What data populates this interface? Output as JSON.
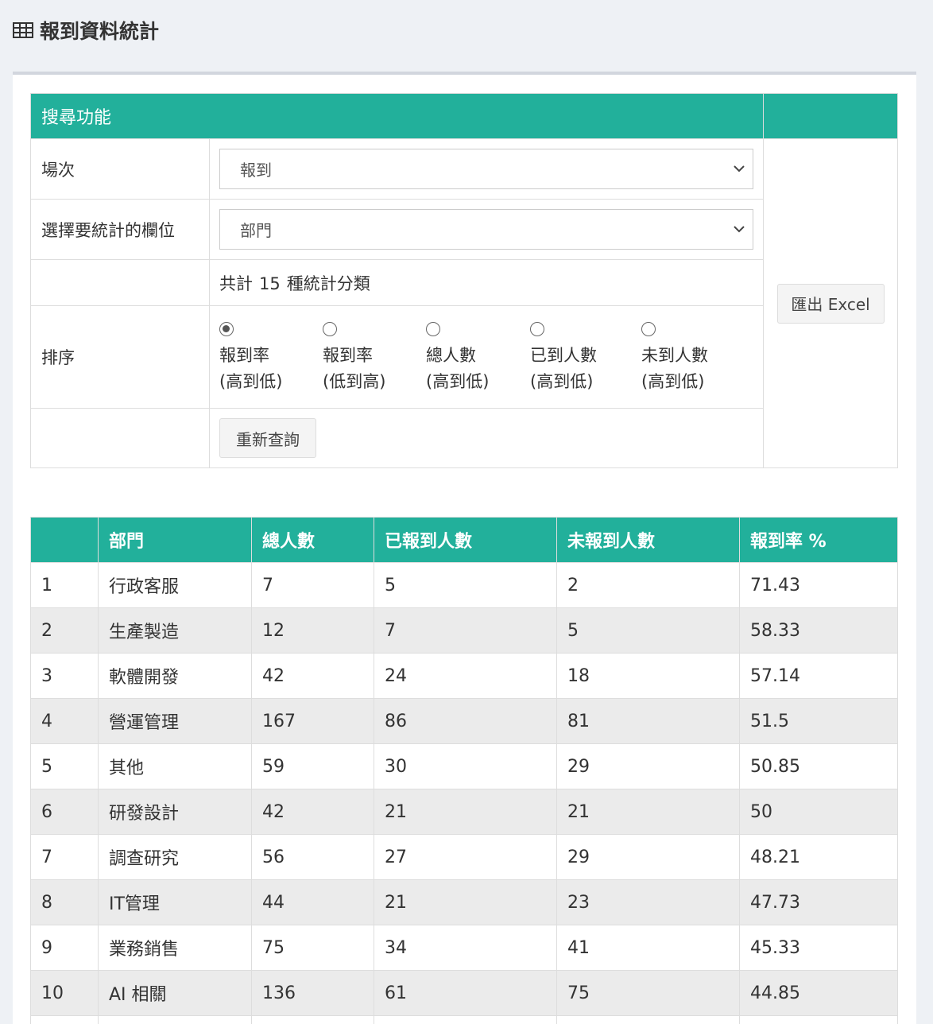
{
  "page": {
    "title": "報到資料統計",
    "title_icon": "table-icon"
  },
  "search": {
    "header": "搜尋功能",
    "rows": {
      "session_label": "場次",
      "session_value": "報到",
      "field_label": "選擇要統計的欄位",
      "field_value": "部門",
      "count_prefix": "共計",
      "count_value": "15",
      "count_suffix": "種統計分類",
      "sort_label": "排序"
    },
    "sort_options": [
      {
        "line1": "報到率",
        "line2": "(高到低)",
        "checked": true
      },
      {
        "line1": "報到率",
        "line2": "(低到高)",
        "checked": false
      },
      {
        "line1": "總人數",
        "line2": "(高到低)",
        "checked": false
      },
      {
        "line1": "已到人數",
        "line2": "(高到低)",
        "checked": false
      },
      {
        "line1": "未到人數",
        "line2": "(高到低)",
        "checked": false
      }
    ],
    "requery_button": "重新查詢",
    "export_button": "匯出 Excel"
  },
  "results": {
    "columns": [
      "",
      "部門",
      "總人數",
      "已報到人數",
      "未報到人數",
      "報到率 %"
    ],
    "rows": [
      [
        "1",
        "行政客服",
        "7",
        "5",
        "2",
        "71.43"
      ],
      [
        "2",
        "生產製造",
        "12",
        "7",
        "5",
        "58.33"
      ],
      [
        "3",
        "軟體開發",
        "42",
        "24",
        "18",
        "57.14"
      ],
      [
        "4",
        "營運管理",
        "167",
        "86",
        "81",
        "51.5"
      ],
      [
        "5",
        "其他",
        "59",
        "30",
        "29",
        "50.85"
      ],
      [
        "6",
        "研發設計",
        "42",
        "21",
        "21",
        "50"
      ],
      [
        "7",
        "調查研究",
        "56",
        "27",
        "29",
        "48.21"
      ],
      [
        "8",
        "IT管理",
        "44",
        "21",
        "23",
        "47.73"
      ],
      [
        "9",
        "業務銷售",
        "75",
        "34",
        "41",
        "45.33"
      ],
      [
        "10",
        "AI 相關",
        "136",
        "61",
        "75",
        "44.85"
      ],
      [
        "",
        "",
        "",
        "",
        "",
        ""
      ]
    ]
  },
  "colors": {
    "accent": "#22b09b",
    "background": "#eef1f5",
    "stripe": "#ebebeb"
  }
}
